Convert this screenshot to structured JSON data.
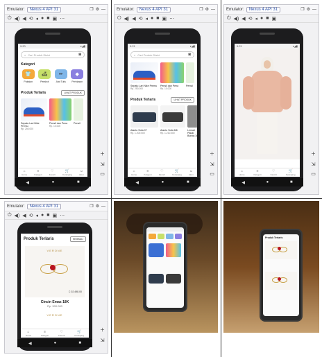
{
  "emulator": {
    "label": "Emulator:",
    "device": "Nexus 4 API 31"
  },
  "app": {
    "search_placeholder": "Cari Produk Disini",
    "category_title": "Kategori",
    "categories": [
      {
        "label": "Pakaian",
        "icon": "shirt-icon",
        "color": "#f4a93a"
      },
      {
        "label": "Perabot",
        "icon": "sofa-icon",
        "color": "#c6e06a"
      },
      {
        "label": "Alat Tulis",
        "icon": "pencil-icon",
        "color": "#7fb6e8"
      },
      {
        "label": "Perhiasan",
        "icon": "diamond-icon",
        "color": "#8b7fe0"
      }
    ],
    "best_seller_title": "Produk Terlaris",
    "see_all": "LIHAT PRODUK",
    "products": [
      {
        "name": "Sepatu Lari Nike Premu",
        "price": "Rp. 250.000"
      },
      {
        "name": "Pensil dan Pena",
        "price": "Rp. 10.000"
      },
      {
        "name": "Pensil",
        "price": "Rp."
      }
    ],
    "furniture": [
      {
        "name": "Alanto Sofa 07",
        "price": "Rp. 1.200.000"
      },
      {
        "name": "Alanto Sofa M8",
        "price": "Rp. 1.210.000"
      },
      {
        "name": "Lemari Pakai Bunda 3L",
        "price": "Rp. 2.060.000"
      }
    ],
    "nav": [
      {
        "label": "Home",
        "icon": "home-icon"
      },
      {
        "label": "Kategori",
        "icon": "menu-icon"
      },
      {
        "label": "Favorit",
        "icon": "heart-icon"
      },
      {
        "label": "Keranjang",
        "icon": "cart-icon"
      },
      {
        "label": "Akun",
        "icon": "user-icon"
      }
    ],
    "detail": {
      "title": "Produk Terlaris",
      "button": "KEMBALI",
      "brand": "VERONE",
      "item_name": "Cincin Emas 18K",
      "item_price": "Rp. 300.000",
      "tag_price": "C 02.498.00"
    }
  },
  "colors": {
    "phone": "#1c1c1e",
    "wood": "#7a4a20",
    "floor": "#b9945f"
  }
}
